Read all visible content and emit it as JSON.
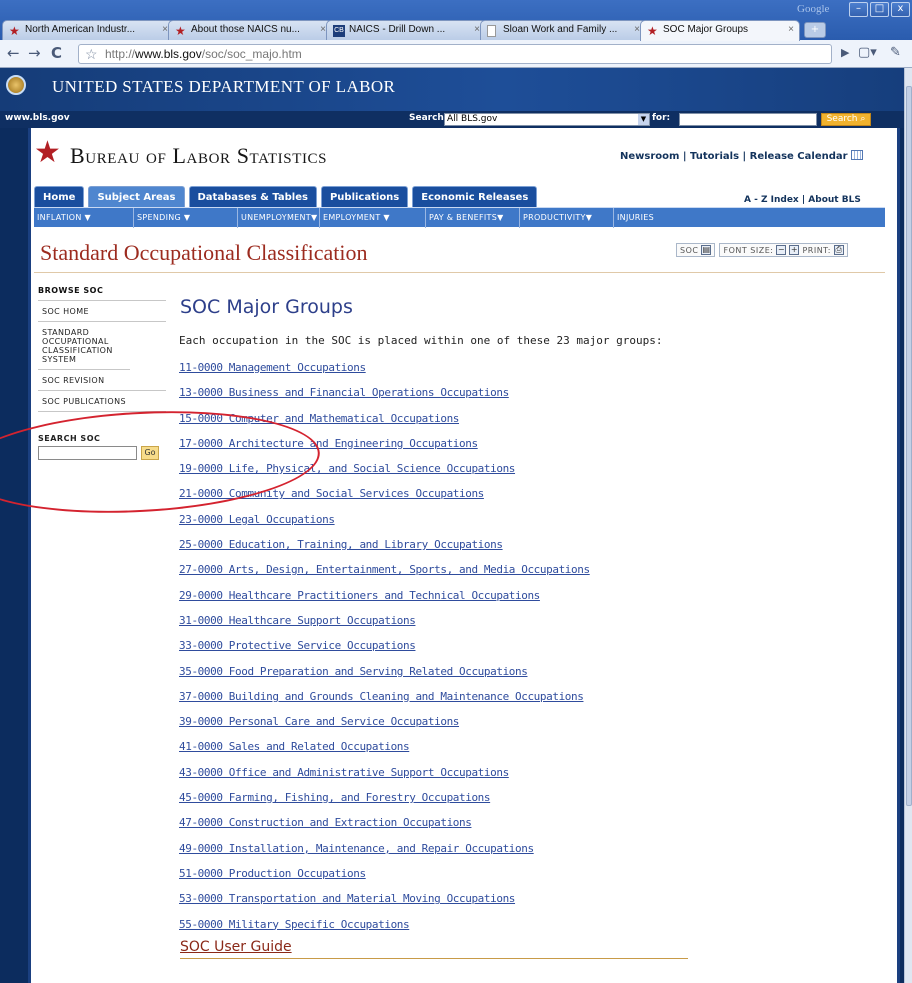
{
  "browser": {
    "tabs": [
      {
        "label": "North American Industr...",
        "close": "×"
      },
      {
        "label": "About those NAICS nu...",
        "close": "×"
      },
      {
        "label": "NAICS - Drill Down ...",
        "close": "×"
      },
      {
        "label": "Sloan Work and Family ...",
        "close": "×"
      },
      {
        "label": "SOC Major Groups",
        "close": "×"
      }
    ],
    "new_tab": "+",
    "corner_label": "Google",
    "url_prefix": "http://",
    "url_host": "www.bls.gov",
    "url_path": "/soc/soc_majo.htm",
    "win_buttons": [
      "–",
      "□",
      "x"
    ]
  },
  "dol": {
    "title": "United States Department of Labor",
    "site": "www.bls.gov",
    "search_label": "Search:",
    "search_scope": "All BLS.gov",
    "for_label": "for:",
    "search_button": "Search"
  },
  "bls": {
    "title": "Bureau of Labor Statistics",
    "toplinks": "Newsroom | Tutorials | Release Calendar",
    "nav_tabs": [
      "Home",
      "Subject Areas",
      "Databases & Tables",
      "Publications",
      "Economic Releases"
    ],
    "az_links": "A - Z Index | About BLS",
    "topics": [
      "INFLATION ▼",
      "SPENDING ▼",
      "UNEMPLOYMENT▼",
      "EMPLOYMENT ▼",
      "PAY & BENEFITS▼",
      "PRODUCTIVITY▼",
      "INJURIES"
    ]
  },
  "page": {
    "heading": "Standard Occupational Classification",
    "util_soc": "SOC",
    "util_font": "FONT SIZE:",
    "util_print": "PRINT:"
  },
  "leftnav": {
    "head": "BROWSE SOC",
    "items": [
      "SOC HOME",
      "STANDARD OCCUPATIONAL CLASSIFICATION SYSTEM",
      "SOC REVISION",
      "SOC PUBLICATIONS"
    ],
    "search_label": "SEARCH SOC",
    "go": "Go"
  },
  "main": {
    "title": "SOC Major Groups",
    "intro": "Each occupation in the SOC is placed within one of these 23 major groups:",
    "groups": [
      "11-0000 Management Occupations",
      "13-0000 Business and Financial Operations Occupations",
      "15-0000 Computer and Mathematical Occupations",
      "17-0000 Architecture and Engineering Occupations",
      "19-0000 Life, Physical, and Social Science Occupations",
      "21-0000 Community and Social Services Occupations",
      "23-0000 Legal Occupations",
      "25-0000 Education, Training, and Library Occupations",
      "27-0000 Arts, Design, Entertainment, Sports, and Media Occupations",
      "29-0000 Healthcare Practitioners and Technical Occupations",
      "31-0000 Healthcare Support Occupations",
      "33-0000 Protective Service Occupations",
      "35-0000 Food Preparation and Serving Related Occupations",
      "37-0000 Building and Grounds Cleaning and Maintenance Occupations",
      "39-0000 Personal Care and Service Occupations",
      "41-0000 Sales and Related Occupations",
      "43-0000 Office and Administrative Support Occupations",
      "45-0000 Farming, Fishing, and Forestry Occupations",
      "47-0000 Construction and Extraction Occupations",
      "49-0000 Installation, Maintenance, and Repair Occupations",
      "51-0000 Production Occupations",
      "53-0000 Transportation and Material Moving Occupations",
      "55-0000 Military Specific Occupations"
    ],
    "user_guide": "SOC User Guide"
  },
  "colors": {
    "accent_red": "#9c2b1f",
    "link_blue": "#2f4c9d",
    "nav_blue": "#1a4e9e",
    "annotation_red": "#d4232f"
  }
}
